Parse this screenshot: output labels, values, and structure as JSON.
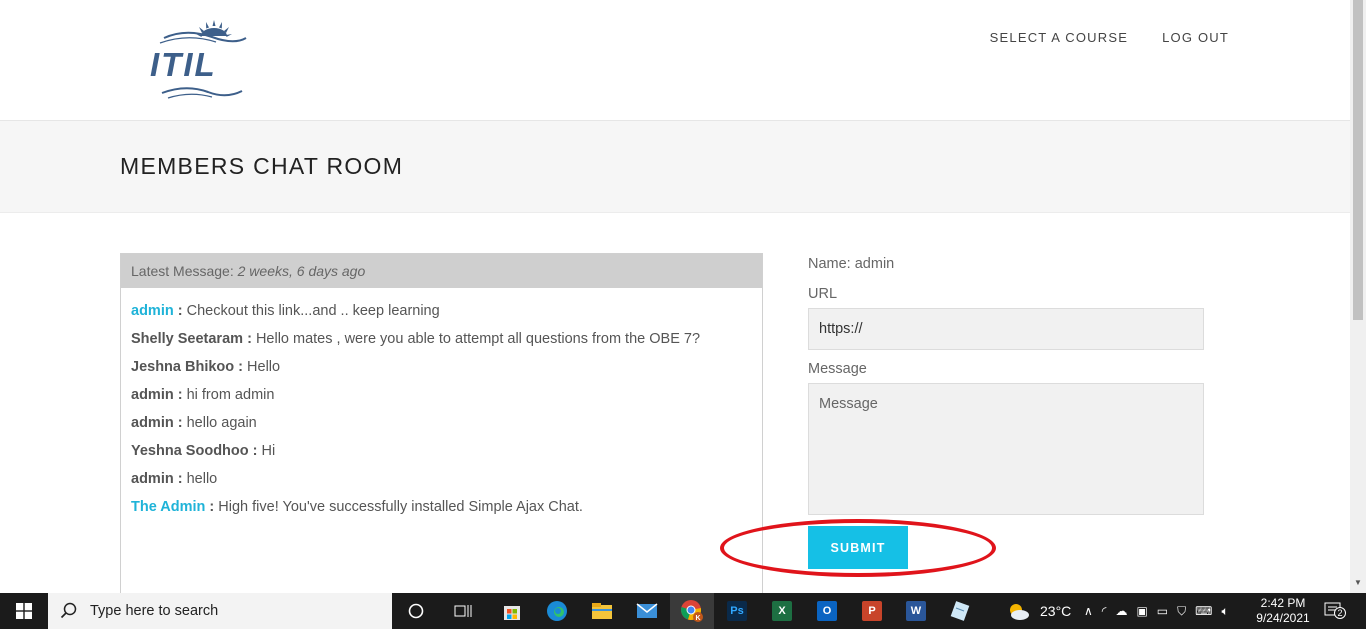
{
  "nav": {
    "select_course": "SELECT A COURSE",
    "logout": "LOG OUT"
  },
  "logo": {
    "text": "ITIL"
  },
  "page_title": "MEMBERS CHAT ROOM",
  "chat": {
    "latest_label": "Latest Message:",
    "latest_time": "2 weeks, 6 days ago",
    "messages": [
      {
        "author": "admin",
        "sep": " : ",
        "text": "Checkout this link...and .. keep learning",
        "link": true
      },
      {
        "author": "Shelly Seetaram",
        "sep": " : ",
        "text": "Hello mates , were you able to attempt all questions from the OBE 7?",
        "link": false
      },
      {
        "author": "Jeshna Bhikoo",
        "sep": " : ",
        "text": "Hello",
        "link": false
      },
      {
        "author": "admin",
        "sep": " : ",
        "text": "hi from admin",
        "link": false
      },
      {
        "author": "admin",
        "sep": " : ",
        "text": "hello again",
        "link": false
      },
      {
        "author": "Yeshna Soodhoo",
        "sep": " : ",
        "text": "Hi",
        "link": false
      },
      {
        "author": "admin",
        "sep": " : ",
        "text": "hello",
        "link": false
      },
      {
        "author": "The Admin",
        "sep": " : ",
        "text": "High five! You've successfully installed Simple Ajax Chat.",
        "link": true
      }
    ]
  },
  "form": {
    "name_label": "Name: admin",
    "url_label": "URL",
    "url_value": "https://",
    "message_label": "Message",
    "message_placeholder": "Message",
    "submit_label": "SUBMIT"
  },
  "taskbar": {
    "search_placeholder": "Type here to search",
    "weather_temp": "23°C",
    "time": "2:42 PM",
    "date": "9/24/2021",
    "notification_count": "2",
    "apps": [
      "cortana-icon",
      "task-view-icon",
      "store-icon",
      "edge-icon",
      "file-explorer-icon",
      "mail-icon",
      "chrome-icon",
      "photoshop-icon",
      "excel-icon",
      "outlook-icon",
      "powerpoint-icon",
      "word-icon",
      "notepad-icon"
    ]
  },
  "colors": {
    "accent": "#15c0e6",
    "link": "#1fb3d8",
    "highlight_ellipse": "#e0141b",
    "logo_blue": "#3d5f8a"
  }
}
